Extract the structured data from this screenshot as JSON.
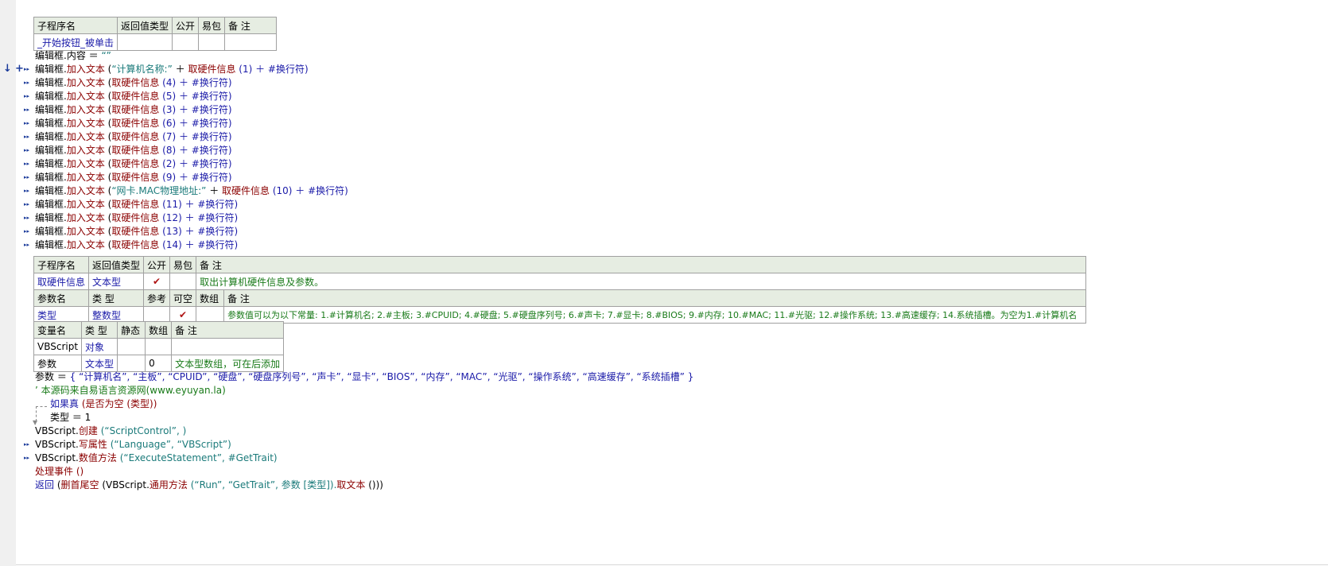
{
  "sub1": {
    "headers": [
      "子程序名",
      "返回值类型",
      "公开",
      "易包",
      "备 注"
    ],
    "row": {
      "name": "_开始按钮_被单击",
      "ret": "",
      "public": "",
      "pkg": "",
      "note": ""
    }
  },
  "code1": [
    {
      "pre": "编辑框.内容 ＝ ",
      "str": "“”"
    },
    {
      "pre": "编辑框.",
      "fn": "加入文本",
      "mid": " (",
      "str": "“计算机名称:”",
      "plus": " ＋ ",
      "fn2": "取硬件信息",
      "arg": " (1) ＋ #换行符)"
    },
    {
      "pre": "编辑框.",
      "fn": "加入文本",
      "mid": " (",
      "fn2": "取硬件信息",
      "arg": " (4) ＋ #换行符)"
    },
    {
      "pre": "编辑框.",
      "fn": "加入文本",
      "mid": " (",
      "fn2": "取硬件信息",
      "arg": " (5) ＋ #换行符)"
    },
    {
      "pre": "编辑框.",
      "fn": "加入文本",
      "mid": " (",
      "fn2": "取硬件信息",
      "arg": " (3) ＋ #换行符)"
    },
    {
      "pre": "编辑框.",
      "fn": "加入文本",
      "mid": " (",
      "fn2": "取硬件信息",
      "arg": " (6) ＋ #换行符)"
    },
    {
      "pre": "编辑框.",
      "fn": "加入文本",
      "mid": " (",
      "fn2": "取硬件信息",
      "arg": " (7) ＋ #换行符)"
    },
    {
      "pre": "编辑框.",
      "fn": "加入文本",
      "mid": " (",
      "fn2": "取硬件信息",
      "arg": " (8) ＋ #换行符)"
    },
    {
      "pre": "编辑框.",
      "fn": "加入文本",
      "mid": " (",
      "fn2": "取硬件信息",
      "arg": " (2) ＋ #换行符)"
    },
    {
      "pre": "编辑框.",
      "fn": "加入文本",
      "mid": " (",
      "fn2": "取硬件信息",
      "arg": " (9) ＋ #换行符)"
    },
    {
      "pre": "编辑框.",
      "fn": "加入文本",
      "mid": " (",
      "str": "“网卡.MAC物理地址:”",
      "plus": " ＋ ",
      "fn2": "取硬件信息",
      "arg": " (10) ＋ #换行符)"
    },
    {
      "pre": "编辑框.",
      "fn": "加入文本",
      "mid": " (",
      "fn2": "取硬件信息",
      "arg": " (11) ＋ #换行符)"
    },
    {
      "pre": "编辑框.",
      "fn": "加入文本",
      "mid": " (",
      "fn2": "取硬件信息",
      "arg": " (12) ＋ #换行符)"
    },
    {
      "pre": "编辑框.",
      "fn": "加入文本",
      "mid": " (",
      "fn2": "取硬件信息",
      "arg": " (13) ＋ #换行符)"
    },
    {
      "pre": "编辑框.",
      "fn": "加入文本",
      "mid": " (",
      "fn2": "取硬件信息",
      "arg": " (14) ＋ #换行符)"
    }
  ],
  "sub2": {
    "headers": [
      "子程序名",
      "返回值类型",
      "公开",
      "易包",
      "备 注"
    ],
    "row": {
      "name": "取硬件信息",
      "ret": "文本型",
      "public": "✔",
      "pkg": "",
      "note": "取出计算机硬件信息及参数。"
    },
    "param_headers": [
      "参数名",
      "类 型",
      "参考",
      "可空",
      "数组",
      "备 注"
    ],
    "param_row": {
      "name": "类型",
      "type": "整数型",
      "ref": "",
      "nullable": "✔",
      "arr": "",
      "note": "参数值可以为以下常量: 1.#计算机名; 2.#主板; 3.#CPUID; 4.#硬盘; 5.#硬盘序列号; 6.#声卡; 7.#显卡; 8.#BIOS; 9.#内存; 10.#MAC; 11.#光驱; 12.#操作系统; 13.#高速缓存; 14.系统插槽。为空为1.#计算机名"
    }
  },
  "vars": {
    "headers": [
      "变量名",
      "类 型",
      "静态",
      "数组",
      "备 注"
    ],
    "rows": [
      {
        "name": "VBScript",
        "type": "对象",
        "static": "",
        "arr": "",
        "note": ""
      },
      {
        "name": "参数",
        "type": "文本型",
        "static": "",
        "arr": "0",
        "note": "文本型数组，可在后添加"
      }
    ]
  },
  "code2": {
    "params_line_pre": "参数 ＝ ",
    "params_line_val": "{ “计算机名”, “主板”, “CPUID”, “硬盘”, “硬盘序列号”, “声卡”, “显卡”, “BIOS”, “内存”, “MAC”, “光驱”, “操作系统”, “高速缓存”, “系统插槽” }",
    "comment": "’ 本源码来自易语言资源网(www.eyuyan.la)",
    "if_kw": "如果真",
    "if_args": " (是否为空 (类型))",
    "assign": "类型 ＝ 1",
    "create_pre": "VBScript.",
    "create_fn": "创建",
    "create_args": " (“ScriptControl”, )",
    "write_pre": "VBScript.",
    "write_fn": "写属性",
    "write_args": " (“Language”, “VBScript”)",
    "num_pre": "VBScript.",
    "num_fn": "数值方法",
    "num_args": " (“ExecuteStatement”, #GetTrait)",
    "evt": "处理事件 ()",
    "ret_kw": "返回",
    "ret_a": " (",
    "ret_fn": "删首尾空",
    "ret_b": " (VBScript.",
    "ret_fn2": "通用方法",
    "ret_c": " (“Run”, “GetTrait”, 参数 [类型]).",
    "ret_fn3": "取文本",
    "ret_d": " ()))"
  }
}
